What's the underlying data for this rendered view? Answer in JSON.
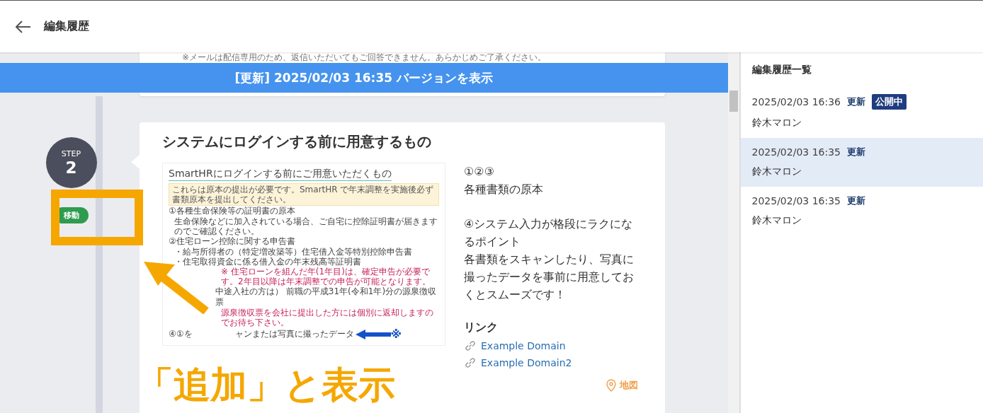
{
  "header": {
    "title": "編集履歴"
  },
  "previous_card": {
    "note": "※メールは配信専用のため、返信いただいてもご回答できません。あらかじめご了承ください。"
  },
  "banner": {
    "label": "[更新] 2025/02/03 16:35 バージョンを表示"
  },
  "step": {
    "label": "STEP",
    "number": "2",
    "badge": "移動"
  },
  "card": {
    "title": "システムにログインする前に用意するもの",
    "slide": {
      "title": "SmartHRにログインする前にご用意いただくもの",
      "notice": "これらは原本の提出が必要です。SmartHR で年末調整を実施後必ず書類原本を提出してください。",
      "items": [
        {
          "kind": "item",
          "text": "①各種生命保険等の証明書の原本"
        },
        {
          "kind": "note",
          "text": "生命保険などに加入されている場合、ご自宅に控除証明書が届きますのでご確認ください。"
        },
        {
          "kind": "item",
          "text": "②住宅ローン控除に関する申告書"
        },
        {
          "kind": "note",
          "text": "・給与所得者の（特定増改築等）住宅借入金等特別控除申告書"
        },
        {
          "kind": "note",
          "text": "・住宅取得資金に係る借入金の年末残高等証明書"
        },
        {
          "kind": "warning",
          "text": "※ 住宅ローンを組んだ年(1年目)は、確定申告が必要です。2年目以降は年末調整での申告が可能となります。"
        },
        {
          "kind": "item",
          "text": "中途入社の方は） 前職の平成31年(令和1年)分の源泉徴収票"
        },
        {
          "kind": "warning",
          "text": "源泉徴収票を会社に提出した方には個別に返却しますのでお待ち下さい。"
        },
        {
          "kind": "pointer",
          "text": "④①を",
          "rest": "ャンまたは写真に撮ったデータ",
          "mark": "※"
        }
      ]
    },
    "body": [
      [
        "①②③",
        "各種書類の原本"
      ],
      [
        "④システム入力が格段にラクになるポイント",
        "各書類をスキャンしたり、写真に撮ったデータを事前に用意しておくとスムーズです！"
      ]
    ],
    "links_heading": "リンク",
    "links": [
      "Example Domain",
      "Example Domain2"
    ],
    "map_label": "地図"
  },
  "annotation": {
    "text": "「追加」と表示"
  },
  "history": {
    "title": "編集履歴一覧",
    "items": [
      {
        "datetime": "2025/02/03 16:36",
        "action": "更新",
        "status": "公開中",
        "author": "鈴木マロン",
        "selected": false
      },
      {
        "datetime": "2025/02/03 16:35",
        "action": "更新",
        "author": "鈴木マロン",
        "selected": true
      },
      {
        "datetime": "2025/02/03 16:35",
        "action": "更新",
        "author": "鈴木マロン",
        "selected": false
      }
    ]
  }
}
